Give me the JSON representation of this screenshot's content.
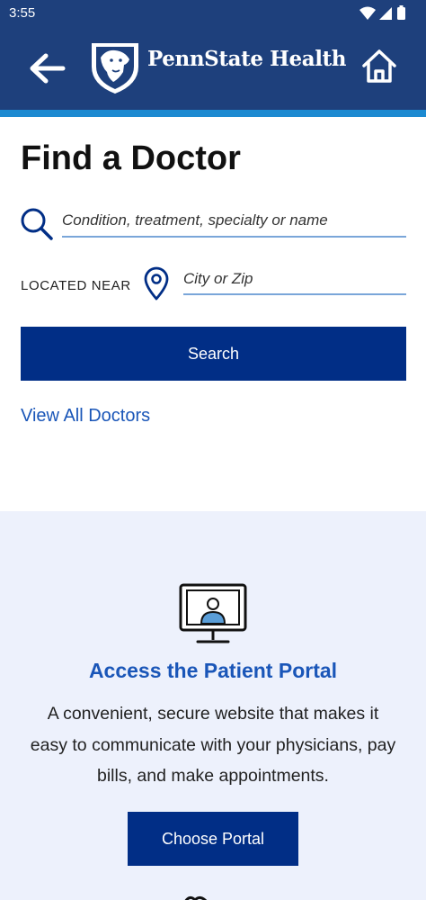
{
  "status_bar": {
    "time": "3:55",
    "icons": [
      "wifi-icon",
      "signal-icon",
      "battery-icon"
    ]
  },
  "header": {
    "brand": "PennState Health",
    "back_icon": "arrow-left-icon",
    "home_icon": "home-icon",
    "logo": "nittany-lion-shield-logo"
  },
  "find_doctor": {
    "title": "Find a Doctor",
    "search_placeholder": "Condition, treatment, specialty or name",
    "search_value": "",
    "located_near_label": "LOCATED NEAR",
    "location_placeholder": "City or Zip",
    "location_value": "",
    "search_button": "Search",
    "view_all_link": "View All Doctors"
  },
  "patient_portal": {
    "title": "Access the Patient Portal",
    "description": "A convenient, secure website that makes it easy to communicate with your physicians, pay bills, and make appointments.",
    "button": "Choose Portal",
    "icon": "monitor-user-icon"
  },
  "colors": {
    "header_bg": "#1e407c",
    "accent_stripe": "#1c8ad1",
    "primary_button": "#012e86",
    "link": "#1a56b8",
    "portal_bg": "#edf1fc"
  }
}
